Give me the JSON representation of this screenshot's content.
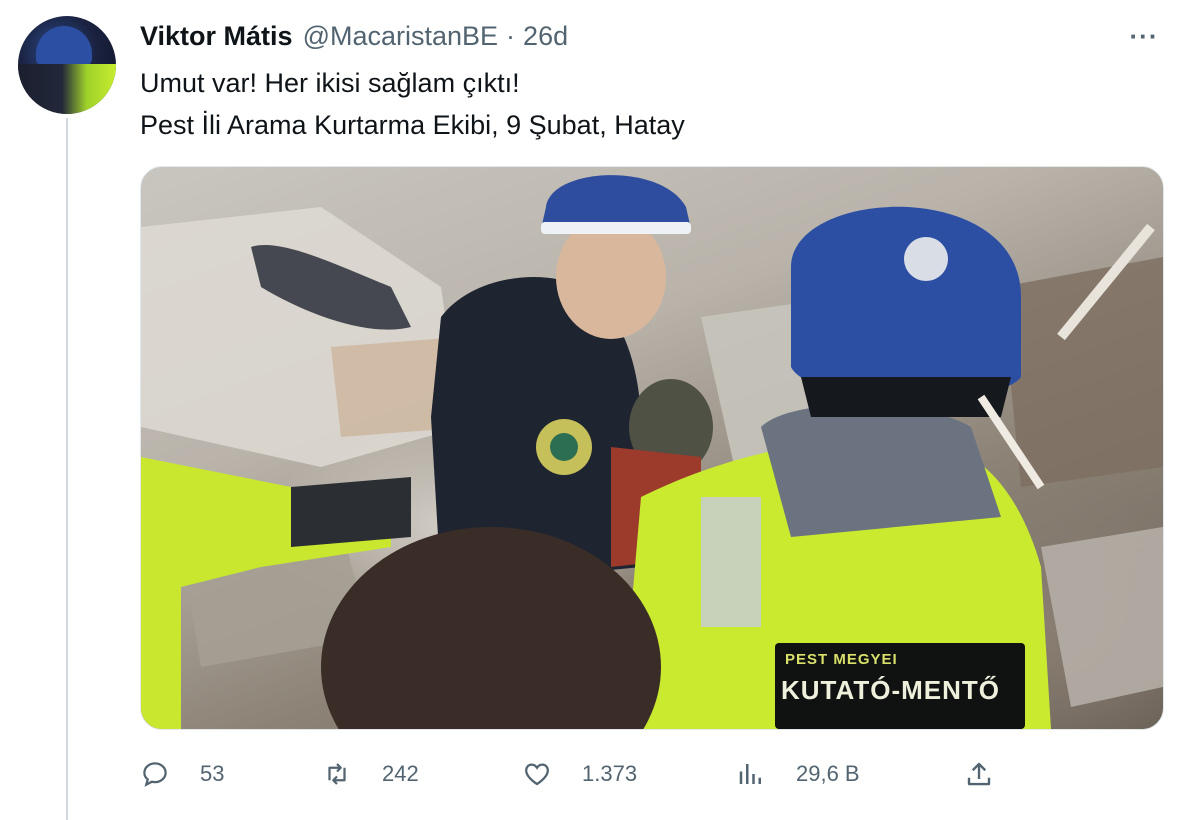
{
  "tweet": {
    "author_name": "Viktor Mátis",
    "author_handle": "@MacaristanBE",
    "separator": "·",
    "time": "26d",
    "more_label": "···",
    "text_lines": [
      "Umut var! Her ikisi sağlam çıktı!",
      "Pest İli Arama Kurtarma Ekibi, 9 Şubat, Hatay"
    ]
  },
  "media": {
    "vest_line1": "PEST MEGYEI",
    "vest_line2": "KUTATÓ-MENTŐ"
  },
  "actions": {
    "reply": {
      "icon": "reply-icon",
      "count": "53"
    },
    "retweet": {
      "icon": "retweet-icon",
      "count": "242"
    },
    "like": {
      "icon": "heart-icon",
      "count": "1.373"
    },
    "views": {
      "icon": "views-chart-icon",
      "count": "29,6 B"
    },
    "share": {
      "icon": "share-icon"
    }
  },
  "colors": {
    "text_primary": "#0f1419",
    "text_secondary": "#536471",
    "thread_line": "#cfd9de"
  }
}
